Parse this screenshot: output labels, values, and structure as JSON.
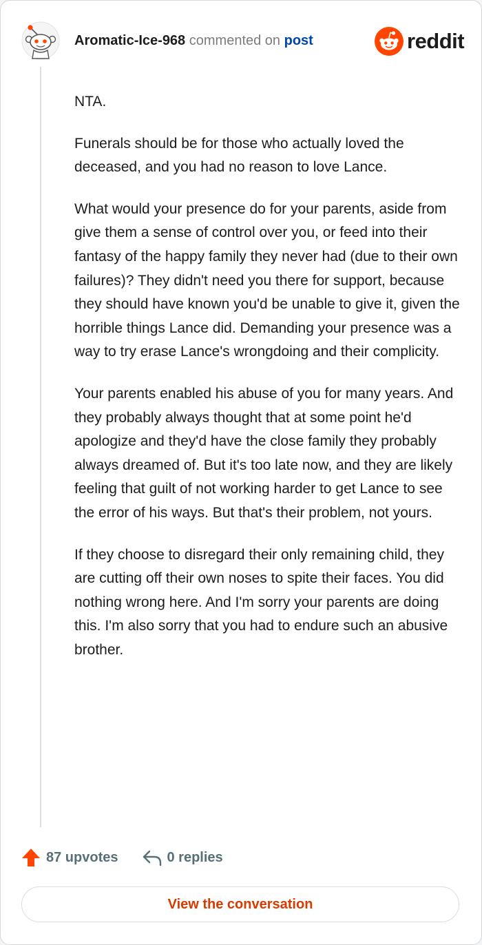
{
  "comment": {
    "username": "Aromatic-Ice-968",
    "action_text": "commented on",
    "post_link_text": "post",
    "paragraphs": [
      "NTA.",
      "Funerals should be for those who actually loved the deceased, and you had no reason to love Lance.",
      "What would your presence do for your parents, aside from give them a sense of control over you, or feed into their fantasy of the happy family they never had (due to their own failures)? They didn't need you there for support, because they should have known you'd be unable to give it, given the horrible things Lance did. Demanding your presence was a way to try erase Lance's wrongdoing and their complicity.",
      "Your parents enabled his abuse of you for many years. And they probably always thought that at some point he'd apologize and they'd have the close family they probably always dreamed of. But it's too late now, and they are likely feeling that guilt of not working harder to get Lance to see the error of his ways. But that's their problem, not yours.",
      "If they choose to disregard their only remaining child, they are cutting off their own noses to spite their faces. You did nothing wrong here. And I'm sorry your parents are doing this. I'm also sorry that you had to endure such an abusive brother."
    ]
  },
  "brand": {
    "name": "reddit",
    "logo_icon": "reddit-snoo-icon",
    "color": "#ff4500"
  },
  "avatar": {
    "icon": "snoo-avatar-icon"
  },
  "footer": {
    "upvotes_label": "87 upvotes",
    "upvote_icon": "upvote-arrow-icon",
    "upvote_color": "#ff4500",
    "replies_label": "0 replies",
    "reply_icon": "reply-arrow-icon"
  },
  "cta": {
    "label": "View the conversation",
    "color": "#d93a00"
  }
}
